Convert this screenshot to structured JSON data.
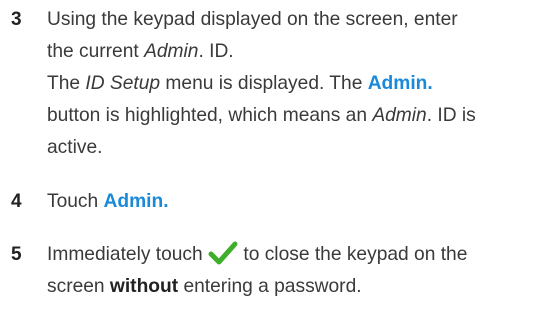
{
  "steps": [
    {
      "number": "3",
      "line1_a": "Using the keypad displayed on the screen, enter",
      "line2_a": "the current ",
      "line2_em": "Admin",
      "line2_b": ". ID.",
      "note_a": "The ",
      "note_em1": "ID Setup",
      "note_b": " menu is displayed. The ",
      "note_link": "Admin.",
      "note_c": "button is highlighted, which means an ",
      "note_em2": "Admin",
      "note_d": ". ID is",
      "note_e": "active."
    },
    {
      "number": "4",
      "text_a": "Touch ",
      "link": "Admin."
    },
    {
      "number": "5",
      "text_a": "Immediately touch ",
      "text_b": " to close the keypad on the",
      "text_c": "screen ",
      "bold": "without",
      "text_d": " entering a password."
    }
  ],
  "icons": {
    "check": "checkmark-icon",
    "check_color": "#3fae2a"
  },
  "colors": {
    "link": "#1a8ad8",
    "text": "#3a3a3a"
  }
}
